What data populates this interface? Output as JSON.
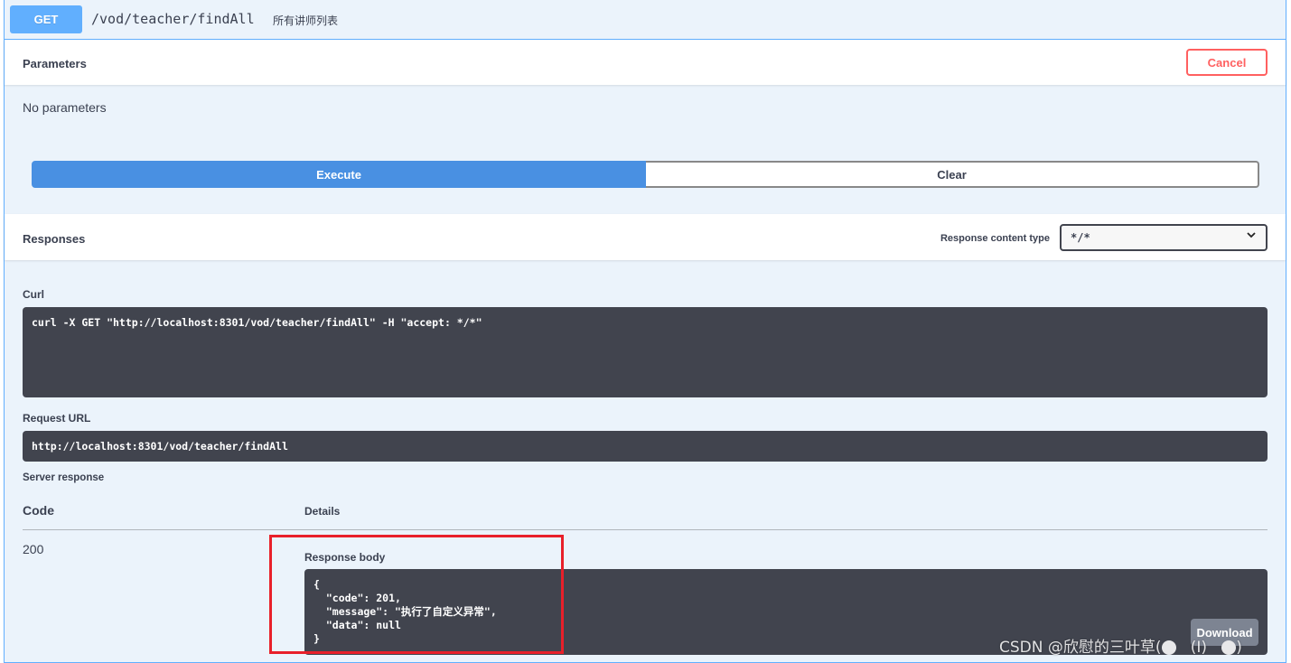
{
  "summary": {
    "method": "GET",
    "path": "/vod/teacher/findAll",
    "description": "所有讲师列表"
  },
  "parameters": {
    "title": "Parameters",
    "cancel_label": "Cancel",
    "empty_text": "No parameters"
  },
  "actions": {
    "execute_label": "Execute",
    "clear_label": "Clear"
  },
  "responses": {
    "title": "Responses",
    "content_type_label": "Response content type",
    "content_type_value": "*/*"
  },
  "curl": {
    "label": "Curl",
    "command": "curl -X GET \"http://localhost:8301/vod/teacher/findAll\" -H \"accept: */*\""
  },
  "request_url": {
    "label": "Request URL",
    "value": "http://localhost:8301/vod/teacher/findAll"
  },
  "server_response": {
    "label": "Server response",
    "code_header": "Code",
    "details_header": "Details",
    "code": "200",
    "body_label": "Response body",
    "body": "{\n  \"code\": 201,\n  \"message\": \"执行了自定义异常\",\n  \"data\": null\n}",
    "download_label": "Download"
  },
  "watermark": {
    "text": "CSDN @欣慰的三叶草(",
    "tail": "(I)"
  },
  "colors": {
    "method_get": "#61affe",
    "execute": "#4990e2",
    "cancel": "#ff6060",
    "code_bg": "#41444e",
    "highlight": "#e8202a"
  }
}
